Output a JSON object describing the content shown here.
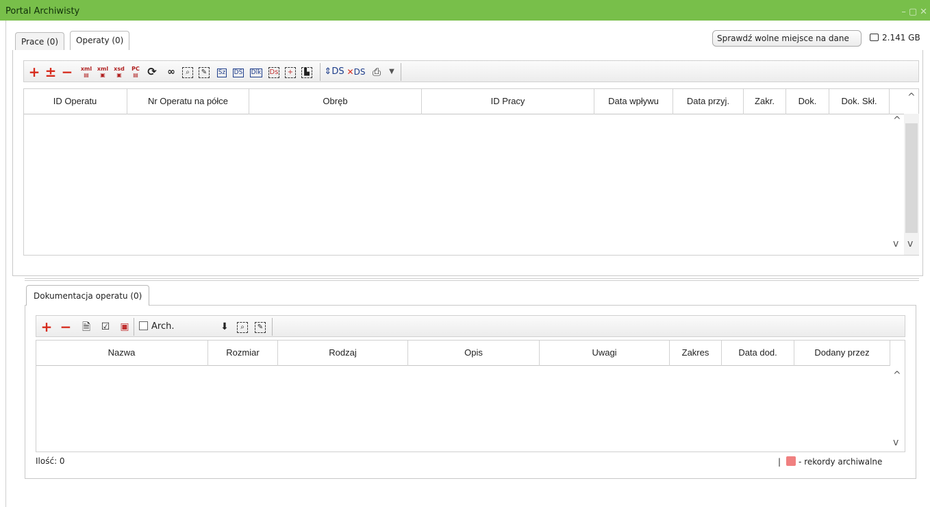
{
  "window": {
    "title": "Portal Archiwisty"
  },
  "top_tabs": [
    {
      "label": "Prace (0)"
    },
    {
      "label": "Operaty (0)"
    }
  ],
  "space_button": {
    "label": "Sprawdź wolne miejsce na dane"
  },
  "disk_free": {
    "value": "2.141 GB"
  },
  "main_toolbar": {
    "items": [
      "+",
      "±",
      "−",
      "xml",
      "xml",
      "xsd",
      "PC",
      "⟳",
      "binoculars",
      "find",
      "edit",
      "Sz",
      "DS",
      "Dlk",
      "Ds",
      "move",
      "paste",
      "DS",
      "DS",
      "print",
      "▾"
    ]
  },
  "operaty_table": {
    "columns": [
      "ID Operatu",
      "Nr Operatu na półce",
      "Obręb",
      "ID Pracy",
      "Data wpływu",
      "Data przyj.",
      "Zakr.",
      "Dok.",
      "Dok. Skł."
    ],
    "rows": []
  },
  "doc_tab": {
    "label": "Dokumentacja operatu (0)"
  },
  "doc_toolbar": {
    "arch_label": "Arch."
  },
  "doc_table": {
    "columns": [
      "Nazwa",
      "Rozmiar",
      "Rodzaj",
      "Opis",
      "Uwagi",
      "Zakres",
      "Data dod.",
      "Dodany przez"
    ],
    "rows": []
  },
  "footer": {
    "count_label": "Ilość: 0",
    "separator": "|",
    "legend_label": "- rekordy archiwalne",
    "legend_color": "#f08080"
  },
  "colors": {
    "titlebar": "#78bf4a",
    "accent_red": "#d62b1d"
  }
}
